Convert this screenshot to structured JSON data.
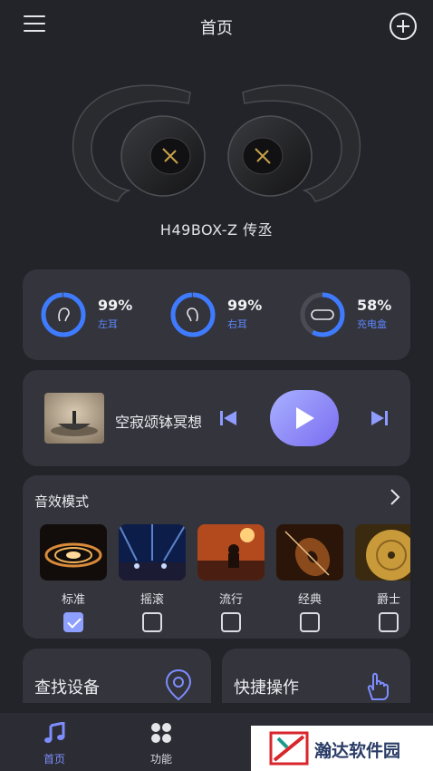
{
  "header": {
    "title": "首页",
    "menu_icon": "hamburger-icon",
    "add_icon": "plus-circle-icon"
  },
  "device": {
    "name": "H49BOX-Z 传丞"
  },
  "battery": [
    {
      "percent_text": "99%",
      "label": "左耳",
      "level": 0.99,
      "icon": "left-ear-icon"
    },
    {
      "percent_text": "99%",
      "label": "右耳",
      "level": 0.99,
      "icon": "right-ear-icon"
    },
    {
      "percent_text": "58%",
      "label": "充电盒",
      "level": 0.58,
      "icon": "charging-case-icon"
    }
  ],
  "player": {
    "track_title": "空寂颂钵冥想",
    "prev_icon": "skip-previous-icon",
    "play_icon": "play-icon",
    "next_icon": "skip-next-icon"
  },
  "sound_modes": {
    "title": "音效模式",
    "items": [
      {
        "label": "标准",
        "checked": true
      },
      {
        "label": "摇滚",
        "checked": false
      },
      {
        "label": "流行",
        "checked": false
      },
      {
        "label": "经典",
        "checked": false
      },
      {
        "label": "爵士",
        "checked": false
      }
    ]
  },
  "tiles": [
    {
      "label": "查找设备",
      "icon": "location-pin-icon"
    },
    {
      "label": "快捷操作",
      "icon": "tap-hand-icon"
    }
  ],
  "tabs": [
    {
      "label": "首页",
      "icon": "music-note-icon",
      "active": true
    },
    {
      "label": "功能",
      "icon": "grid-icon",
      "active": false
    }
  ],
  "watermark": {
    "text": "瀚达软件园"
  },
  "colors": {
    "accent": "#5e88ff",
    "play_gradient_start": "#a9b1ff",
    "play_gradient_end": "#7a6cf1",
    "background": "#23242a",
    "card": "#33343c"
  }
}
